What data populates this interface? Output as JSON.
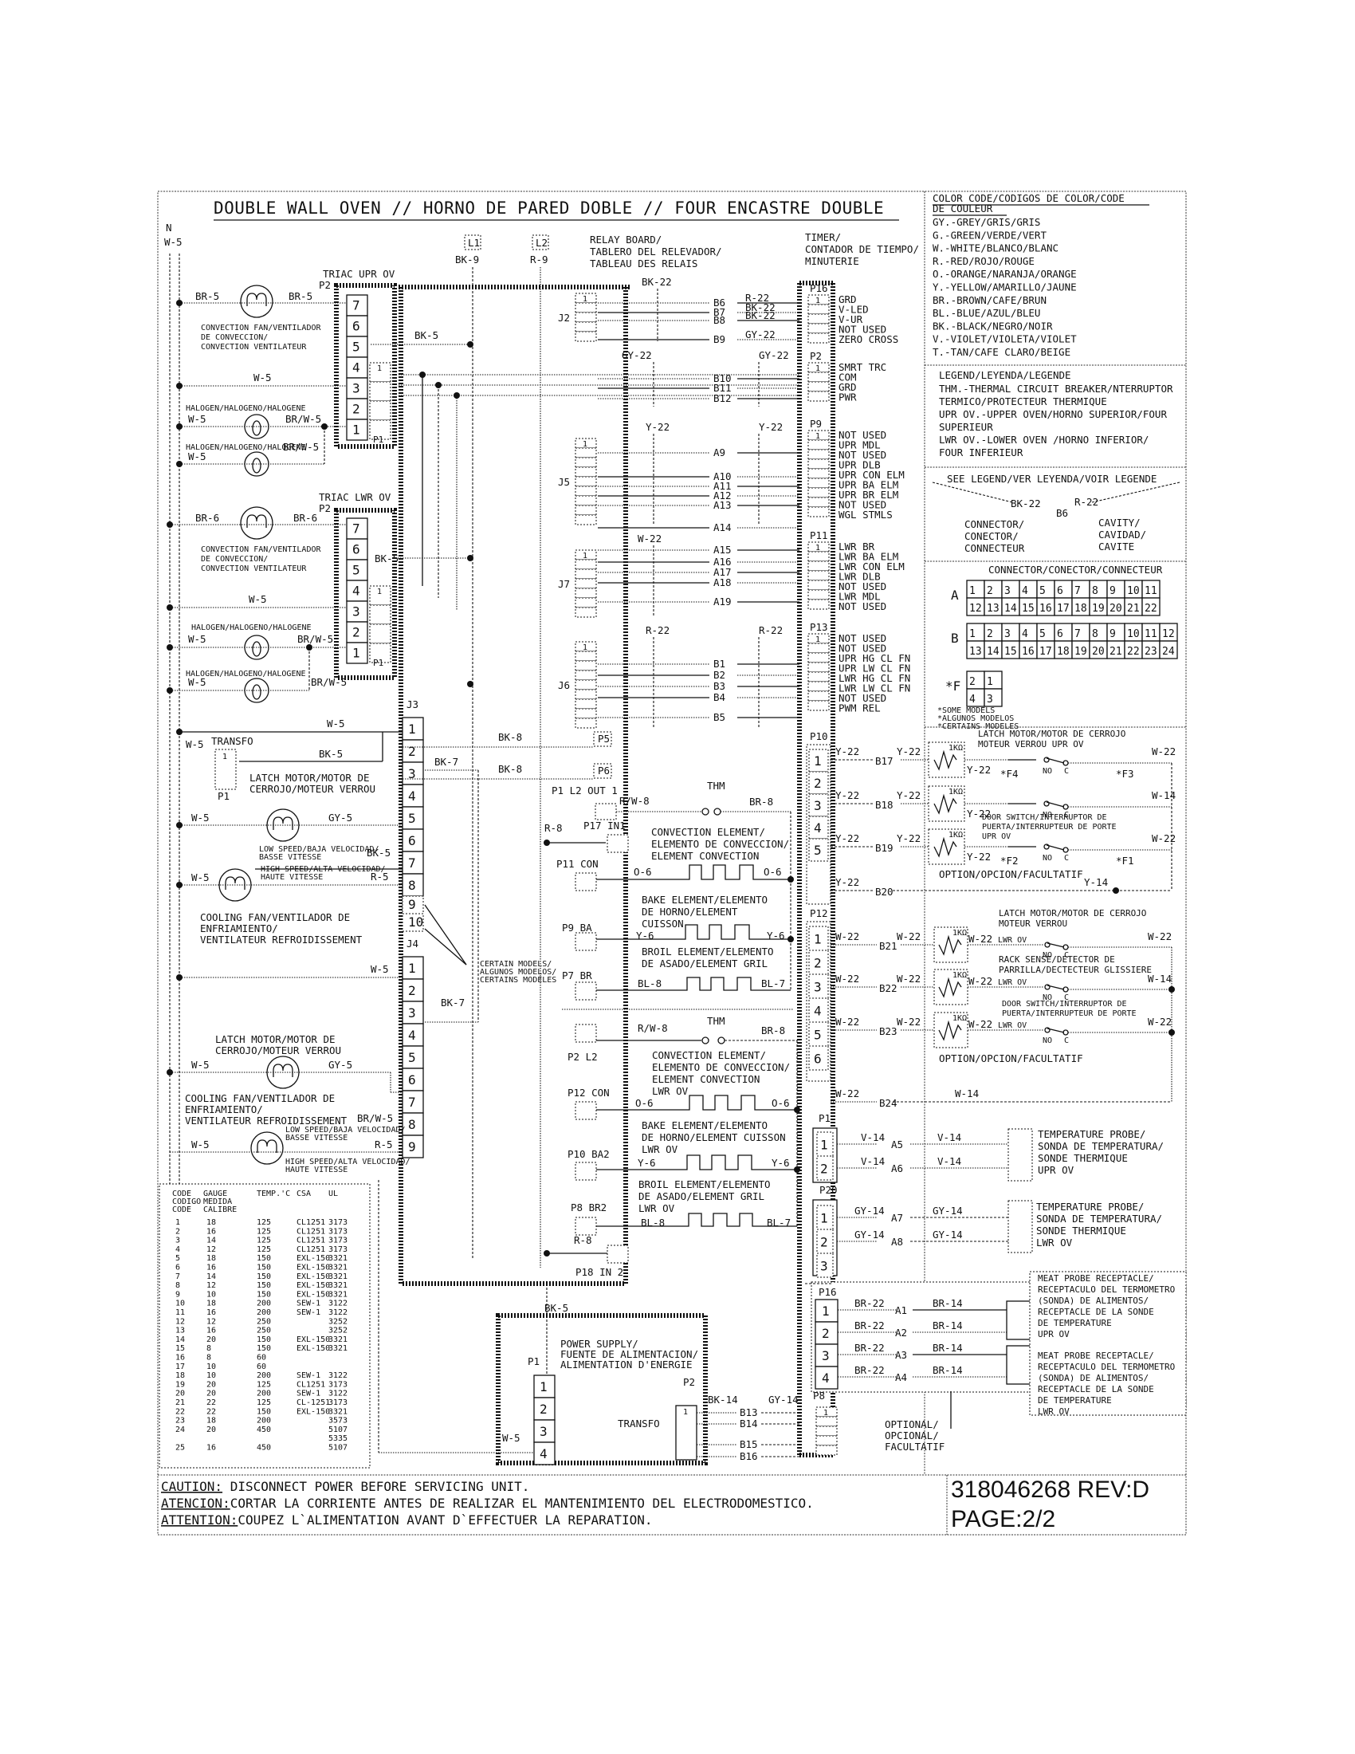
{
  "title": "DOUBLE WALL OVEN // HORNO DE PARED DOBLE // FOUR ENCASTRE DOUBLE",
  "neutral": {
    "label": "N",
    "wire": "W-5"
  },
  "lines": {
    "l1": "L1",
    "l1_wire": "BK-9",
    "l2": "L2",
    "l2_wire": "R-9"
  },
  "relay_board": {
    "label": [
      "RELAY BOARD/",
      "TABLERO DEL RELEVADOR/",
      "TABLEAU  DES RELAIS"
    ]
  },
  "timer": {
    "label": [
      "TIMER/",
      "CONTADOR DE TIEMPO/",
      "MINUTERIE"
    ]
  },
  "triac_upr": {
    "label": "TRIAC UPR OV",
    "connector": "P2",
    "pins": [
      "7",
      "6",
      "5",
      "4",
      "3",
      "2",
      "1"
    ],
    "p1": "P1",
    "p1_pin": "1",
    "fan_label": [
      "CONVECTION FAN/VENTILADOR",
      "DE CONVECCION/",
      "CONVECTION VENTILATEUR"
    ],
    "fan_wires": [
      "BR-5",
      "BR-5"
    ],
    "neutral_wire": "W-5",
    "halogen_label": "HALOGEN/HALOGENO/HALOGENE",
    "halogen_wires": [
      "W-5",
      "BR/W-5",
      "W-5",
      "BR/W-5"
    ],
    "bk_wire": "BK-5"
  },
  "triac_lwr": {
    "label": "TRIAC LWR OV",
    "connector": "P2",
    "pins": [
      "7",
      "6",
      "5",
      "4",
      "3",
      "2",
      "1"
    ],
    "p1": "P1",
    "p1_pin": "1",
    "fan_label": [
      "CONVECTION FAN/VENTILADOR",
      "DE CONVECCION/",
      "CONVECTION VENTILATEUR"
    ],
    "fan_wires": [
      "BR-6",
      "BR-6"
    ],
    "neutral_wire": "W-5",
    "halogen_label": "HALOGEN/HALOGENO/HALOGENE",
    "halogen_wires": [
      "W-5",
      "BR/W-5",
      "W-5",
      "BR/W-5"
    ],
    "bk_wire": "BK-5"
  },
  "j3": {
    "label": "J3",
    "pins": [
      "1",
      "2",
      "3",
      "4",
      "5",
      "6",
      "7",
      "8",
      "9",
      "10"
    ],
    "wires": {
      "w5": "W-5",
      "bk5": "BK-5",
      "transfo": "TRANSFO",
      "transfo_w5": "W-5",
      "p1": "P1",
      "p1_pin": "1",
      "latch_label": [
        "LATCH MOTOR/MOTOR DE",
        "CERROJO/MOTEUR VERROU"
      ],
      "latch_w": "W-5",
      "latch_gy": "GY-5",
      "low_speed": [
        "LOW SPEED/BAJA VELOCIDAD/",
        "BASSE VITESSE"
      ],
      "high_speed": [
        "HIGH SPEED/ALTA VELOCIDAD/",
        "HAUTE VITESSE"
      ],
      "fan_w": "W-5",
      "fan_bk": "BK-5",
      "fan_r": "R-5",
      "bk7": "BK-7",
      "cooling_label": [
        "COOLING FAN/VENTILADOR DE",
        "ENFRIAMIENTO/",
        "VENTILATEUR REFROIDISSEMENT"
      ]
    }
  },
  "j4": {
    "label": "J4",
    "pins": [
      "1",
      "2",
      "3",
      "4",
      "5",
      "6",
      "7",
      "8",
      "9"
    ],
    "wires": {
      "w5": "W-5",
      "bk7": "BK-7",
      "latch_label": [
        "LATCH MOTOR/MOTOR DE",
        "CERROJO/MOTEUR VERROU"
      ],
      "latch_w": "W-5",
      "latch_gy": "GY-5",
      "cooling_label": [
        "COOLING FAN/VENTILADOR DE",
        "ENFRIAMIENTO/",
        "VENTILATEUR REFROIDISSEMENT"
      ],
      "fan_w": "W-5",
      "fan_brw": "BR/W-5",
      "fan_r": "R-5",
      "low_speed": [
        "LOW SPEED/BAJA VELOCIDAD/",
        "BASSE VITESSE"
      ],
      "high_speed": [
        "HIGH SPEED/ALTA VELOCIDAD/",
        "HAUTE VITESSE"
      ]
    }
  },
  "certain_models": [
    "CERTAIN MODELS/",
    "ALGUNOS MODELOS/",
    "CERTAINS MODELES"
  ],
  "relay_connectors": [
    {
      "name": "J2",
      "wire_left": "BK-22",
      "rows": [
        {
          "code": "B6",
          "wire": "R-22"
        },
        {
          "code": "B7",
          "wire": "BK-22"
        },
        {
          "code": "B8",
          "wire": "BK-22"
        },
        {
          "code": "B9",
          "wire": "GY-22"
        }
      ]
    },
    {
      "name": "",
      "wire_left": "GY-22",
      "wire_right": "GY-22",
      "rows": [
        {
          "code": "B10"
        },
        {
          "code": "B11"
        },
        {
          "code": "B12"
        }
      ]
    },
    {
      "name": "J5",
      "wire_left": "Y-22",
      "wire_right": "Y-22",
      "rows": [
        {
          "code": "A9"
        },
        {
          "code": "A10"
        },
        {
          "code": "A11"
        },
        {
          "code": "A12"
        },
        {
          "code": "A13"
        },
        {
          "code": "A14"
        }
      ]
    },
    {
      "name": "J7",
      "wire_left": "W-22",
      "rows": [
        {
          "code": "A15"
        },
        {
          "code": "A16"
        },
        {
          "code": "A17"
        },
        {
          "code": "A18"
        },
        {
          "code": "A19"
        }
      ]
    },
    {
      "name": "J6",
      "wire_left": "R-22",
      "wire_right": "R-22",
      "rows": [
        {
          "code": "B1"
        },
        {
          "code": "B2"
        },
        {
          "code": "B3"
        },
        {
          "code": "B4"
        },
        {
          "code": "B5"
        }
      ]
    }
  ],
  "timer_connectors": [
    {
      "name": "P16",
      "labels": [
        "GRD",
        "V-LED",
        "V-UR",
        "NOT USED",
        "ZERO CROSS"
      ]
    },
    {
      "name": "P2",
      "labels": [
        "SMRT TRC",
        "COM",
        "GRD",
        "PWR"
      ]
    },
    {
      "name": "P9",
      "labels": [
        "NOT USED",
        "UPR MDL",
        "NOT USED",
        "UPR DLB",
        "UPR CON ELM",
        "UPR BA ELM",
        "UPR BR ELM",
        "NOT USED",
        "WGL STMLS"
      ]
    },
    {
      "name": "P11",
      "labels": [
        "LWR BR",
        "LWR BA ELM",
        "LWR CON ELM",
        "LWR DLB",
        "NOT USED",
        "LWR MDL",
        "NOT USED"
      ]
    },
    {
      "name": "P13",
      "labels": [
        "NOT USED",
        "NOT USED",
        "UPR HG CL FN",
        "UPR LW CL FN",
        "LWR HG CL FN",
        "LWR LW CL FN",
        "NOT USED",
        "PWM REL"
      ]
    }
  ],
  "elements_upper": {
    "p5": "P5",
    "p6": "P6",
    "bk8a": "BK-8",
    "bk8b": "BK-8",
    "r8": "R-8",
    "p1_out": "P1 L2 OUT 1",
    "p17": "P17 IN1",
    "thm": "THM",
    "rw8": "R/W-8",
    "br8": "BR-8",
    "conv_label": [
      "CONVECTION ELEMENT/",
      "ELEMENTO DE CONVECCION/",
      "ELEMENT CONVECTION"
    ],
    "p11": "P11 CON",
    "o6a": "O-6",
    "o6b": "O-6",
    "bake_label": [
      "BAKE ELEMENT/ELEMENTO",
      "DE HORNO/ELEMENT",
      "CUISSON"
    ],
    "p9": "P9 BA",
    "y6a": "Y-6",
    "y6b": "Y-6",
    "broil_label": [
      "BROIL ELEMENT/ELEMENTO",
      "DE ASADO/ELEMENT GRIL"
    ],
    "p7": "P7 BR",
    "bl8": "BL-8",
    "bl7": "BL-7"
  },
  "elements_lower": {
    "thm": "THM",
    "rw8": "R/W-8",
    "br8": "BR-8",
    "p2": "P2 L2",
    "conv_label": [
      "CONVECTION ELEMENT/",
      "ELEMENTO DE CONVECCION/",
      "ELEMENT CONVECTION",
      "LWR OV"
    ],
    "p12": "P12 CON",
    "o6a": "O-6",
    "o6b": "O-6",
    "bake_label": [
      "BAKE ELEMENT/ELEMENTO",
      "DE HORNO/ELEMENT CUISSON",
      "LWR OV"
    ],
    "p10": "P10 BA2",
    "y6a": "Y-6",
    "y6b": "Y-6",
    "broil_label": [
      "BROIL ELEMENT/ELEMENTO",
      "DE ASADO/ELEMENT GRIL",
      "LWR OV"
    ],
    "p8": "P8 BR2",
    "bl8": "BL-8",
    "bl7": "BL-7",
    "r8": "R-8",
    "p18": "P18 IN 2"
  },
  "p10_upper_switches": {
    "connector": "P10",
    "pins": [
      "1",
      "2",
      "3",
      "4",
      "5"
    ],
    "rows": [
      {
        "w1": "Y-22",
        "code": "B17",
        "w2": "Y-22",
        "w3": "Y-22",
        "f": "*F4",
        "fr": "*F3",
        "wr": "W-22"
      },
      {
        "w1": "Y-22",
        "code": "B18",
        "w2": "Y-22",
        "w3": "Y-22",
        "wr": "W-14"
      },
      {
        "w1": "Y-22",
        "code": "B19",
        "w2": "Y-22",
        "w3": "Y-22",
        "f": "*F2",
        "fr": "*F1",
        "wr": "W-22"
      },
      {
        "w1": "Y-22",
        "code": "B20",
        "wr": "Y-14"
      }
    ],
    "latch_label": [
      "LATCH MOTOR/MOTOR DE CERROJO",
      "MOTEUR VERROU UPR OV"
    ],
    "door_label": [
      "DOOR SWITCH/INTERRUPTOR DE",
      "PUERTA/INTERRUPTEUR DE PORTE",
      "UPR OV"
    ],
    "option": "OPTION/OPCION/FACULTATIF",
    "res": "1KΩ",
    "no": "NO",
    "c": "C"
  },
  "p12_lower_switches": {
    "connector": "P12",
    "pins": [
      "1",
      "2",
      "3",
      "4",
      "5",
      "6"
    ],
    "rows": [
      {
        "w1": "W-22",
        "code": "B21",
        "w2": "W-22",
        "w3": "W-22",
        "side": "LWR OV",
        "wr": "W-22"
      },
      {
        "w1": "W-22",
        "code": "B22",
        "w2": "W-22",
        "w3": "W-22",
        "side": "LWR OV",
        "wr": "W-14"
      },
      {
        "w1": "W-22",
        "code": "B23",
        "w2": "W-22",
        "w3": "W-22",
        "side": "LWR OV",
        "wr": "W-22"
      },
      {
        "w1": "W-22",
        "code": "B24",
        "wr": "W-14"
      }
    ],
    "latch_label": [
      "LATCH MOTOR/MOTOR DE CERROJO",
      "MOTEUR VERROU"
    ],
    "rack_label": [
      "RACK SENSE/DETECTOR DE",
      "PARRILLA/DECTECTEUR GLISSIERE"
    ],
    "door_label": [
      "DOOR SWITCH/INTERRUPTOR DE",
      "PUERTA/INTERRUPTEUR DE PORTE"
    ],
    "option": "OPTION/OPCION/FACULTATIF"
  },
  "probes": {
    "p1": {
      "connector": "P1",
      "pins": [
        "1",
        "2"
      ],
      "rows": [
        {
          "w1": "V-14",
          "code": "A5",
          "w2": "V-14"
        },
        {
          "w1": "V-14",
          "code": "A6",
          "w2": "V-14"
        }
      ],
      "label": [
        "TEMPERATURE PROBE/",
        "SONDA DE TEMPERATURA/",
        "SONDE THERMIQUE",
        "UPR OV"
      ]
    },
    "p20": {
      "connector": "P20",
      "pins": [
        "1",
        "2",
        "3"
      ],
      "rows": [
        {
          "w1": "GY-14",
          "code": "A7",
          "w2": "GY-14"
        },
        {
          "w1": "GY-14",
          "code": "A8",
          "w2": "GY-14"
        }
      ],
      "label": [
        "TEMPERATURE PROBE/",
        "SONDA DE TEMPERATURA/",
        "SONDE THERMIQUE",
        "LWR OV"
      ]
    },
    "p16": {
      "connector": "P16",
      "pins": [
        "1",
        "2",
        "3",
        "4"
      ],
      "rows": [
        {
          "w1": "BR-22",
          "code": "A1",
          "w2": "BR-14"
        },
        {
          "w1": "BR-22",
          "code": "A2",
          "w2": "BR-14"
        },
        {
          "w1": "BR-22",
          "code": "A3",
          "w2": "BR-14"
        },
        {
          "w1": "BR-22",
          "code": "A4",
          "w2": "BR-14"
        }
      ],
      "label_upr": [
        "MEAT PROBE RECEPTACLE/",
        "RECEPTACULO DEL TERMOMETRO",
        "(SONDA) DE ALIMENTOS/",
        "RECEPTACLE DE LA SONDE",
        "DE TEMPERATURE",
        "UPR OV"
      ],
      "label_lwr": [
        "MEAT PROBE RECEPTACLE/",
        "RECEPTACULO DEL TERMOMETRO",
        "(SONDA) DE ALIMENTOS/",
        "RECEPTACLE DE LA SONDE",
        "DE TEMPERATURE",
        "LWR OV"
      ]
    },
    "optional": [
      "OPTIONAL/",
      "OPCIONAL/",
      "FACULTATIF"
    ]
  },
  "power_supply": {
    "label": [
      "POWER SUPPLY/",
      "FUENTE DE ALIMENTACION/",
      "ALIMENTATION D'ENERGIE"
    ],
    "p1": "P1",
    "p1_pins": [
      "1",
      "2",
      "3",
      "4"
    ],
    "p2": "P2",
    "bk5": "BK-5",
    "w5": "W-5",
    "transfo": "TRANSFO",
    "transfo_pin": "1",
    "bk14": "BK-14",
    "gy14": "GY-14",
    "codes": [
      "B13",
      "B14",
      "B15",
      "B16"
    ],
    "p8": "P8",
    "p8_pin": "1"
  },
  "color_code": {
    "title": [
      "COLOR CODE/CODIGOS DE COLOR/CODE",
      "DE COULEUR"
    ],
    "items": [
      "GY.-GREY/GRIS/GRIS",
      "G.-GREEN/VERDE/VERT",
      "W.-WHITE/BLANCO/BLANC",
      "R.-RED/ROJO/ROUGE",
      "O.-ORANGE/NARANJA/ORANGE",
      "Y.-YELLOW/AMARILLO/JAUNE",
      "BR.-BROWN/CAFE/BRUN",
      "BL.-BLUE/AZUL/BLEU",
      "BK.-BLACK/NEGRO/NOIR",
      "V.-VIOLET/VIOLETA/VIOLET",
      "T.-TAN/CAFE CLARO/BEIGE"
    ]
  },
  "legend": {
    "title": "LEGEND/LEYENDA/LEGENDE",
    "items": [
      "THM.-THERMAL CIRCUIT BREAKER/NTERRUPTOR",
      "TERMICO/PROTECTEUR THERMIQUE",
      "UPR OV.-UPPER OVEN/HORNO SUPERIOR/FOUR",
      "       SUPERIEUR",
      "LWR OV.-LOWER OVEN /HORNO INFERIOR/",
      "       FOUR INFERIEUR"
    ],
    "see_legend": "SEE LEGEND/VER LEYENDA/VOIR LEGENDE",
    "example_left": "BK-22",
    "example_code": "B6",
    "example_right": "R-22",
    "connector_label": [
      "CONNECTOR/",
      "CONECTOR/",
      "CONNECTEUR"
    ],
    "cavity_label": [
      "CAVITY/",
      "CAVIDAD/",
      "CAVITE"
    ]
  },
  "connector_map": {
    "title": "CONNECTOR/CONECTOR/CONNECTEUR",
    "A": {
      "label": "A",
      "rows": [
        [
          "1",
          "2",
          "3",
          "4",
          "5",
          "6",
          "7",
          "8",
          "9",
          "10",
          "11"
        ],
        [
          "12",
          "13",
          "14",
          "15",
          "16",
          "17",
          "18",
          "19",
          "20",
          "21",
          "22"
        ]
      ]
    },
    "B": {
      "label": "B",
      "rows": [
        [
          "1",
          "2",
          "3",
          "4",
          "5",
          "6",
          "7",
          "8",
          "9",
          "10",
          "11",
          "12"
        ],
        [
          "13",
          "14",
          "15",
          "16",
          "17",
          "18",
          "19",
          "20",
          "21",
          "22",
          "23",
          "24"
        ]
      ]
    },
    "F": {
      "label": "*F",
      "rows": [
        [
          "2",
          "1"
        ],
        [
          "4",
          "3"
        ]
      ]
    },
    "notes": [
      "*SOME MODELS",
      "*ALGUNOS MODELOS",
      "*CERTAINS MODELES"
    ]
  },
  "wire_table": {
    "headers": [
      [
        "CODE",
        "CODIGO",
        "CODE"
      ],
      [
        "GAUGE",
        "MEDIDA",
        "CALIBRE"
      ],
      [
        "TEMP.'C"
      ],
      [
        "CSA"
      ],
      [
        "UL"
      ]
    ],
    "rows": [
      [
        "1",
        "18",
        "125",
        "CL1251",
        "3173"
      ],
      [
        "2",
        "16",
        "125",
        "CL1251",
        "3173"
      ],
      [
        "3",
        "14",
        "125",
        "CL1251",
        "3173"
      ],
      [
        "4",
        "12",
        "125",
        "CL1251",
        "3173"
      ],
      [
        "5",
        "18",
        "150",
        "EXL-150",
        "3321"
      ],
      [
        "6",
        "16",
        "150",
        "EXL-150",
        "3321"
      ],
      [
        "7",
        "14",
        "150",
        "EXL-150",
        "3321"
      ],
      [
        "8",
        "12",
        "150",
        "EXL-150",
        "3321"
      ],
      [
        "9",
        "10",
        "150",
        "EXL-150",
        "3321"
      ],
      [
        "10",
        "18",
        "200",
        "SEW-1",
        "3122"
      ],
      [
        "11",
        "16",
        "200",
        "SEW-1",
        "3122"
      ],
      [
        "12",
        "12",
        "250",
        "",
        "3252"
      ],
      [
        "13",
        "16",
        "250",
        "",
        "3252"
      ],
      [
        "14",
        "20",
        "150",
        "EXL-150",
        "3321"
      ],
      [
        "15",
        "8",
        "150",
        "EXL-150",
        "3321"
      ],
      [
        "16",
        "8",
        "60",
        "",
        ""
      ],
      [
        "17",
        "10",
        "60",
        "",
        ""
      ],
      [
        "18",
        "10",
        "200",
        "SEW-1",
        "3122"
      ],
      [
        "19",
        "20",
        "125",
        "CL1251",
        "3173"
      ],
      [
        "20",
        "20",
        "200",
        "SEW-1",
        "3122"
      ],
      [
        "21",
        "22",
        "125",
        "CL-1251",
        "3173"
      ],
      [
        "22",
        "22",
        "150",
        "EXL-150",
        "3321"
      ],
      [
        "23",
        "18",
        "200",
        "",
        "3573"
      ],
      [
        "24",
        "20",
        "450",
        "",
        "5107"
      ],
      [
        "",
        "",
        "",
        "",
        "5335"
      ],
      [
        "25",
        "16",
        "450",
        "",
        "5107"
      ]
    ]
  },
  "footer": {
    "caution_label": "CAUTION:",
    "caution_text": " DISCONNECT POWER BEFORE SERVICING UNIT.",
    "atencion_label": "ATENCION:",
    "atencion_text": "CORTAR LA CORRIENTE ANTES DE REALIZAR EL MANTENIMIENTO DEL ELECTRODOMESTICO.",
    "attention_label": "ATTENTION:",
    "attention_text": "COUPEZ L`ALIMENTATION AVANT D`EFFECTUER LA REPARATION.",
    "part_number": "318046268 REV:D",
    "page": "PAGE:2/2"
  }
}
